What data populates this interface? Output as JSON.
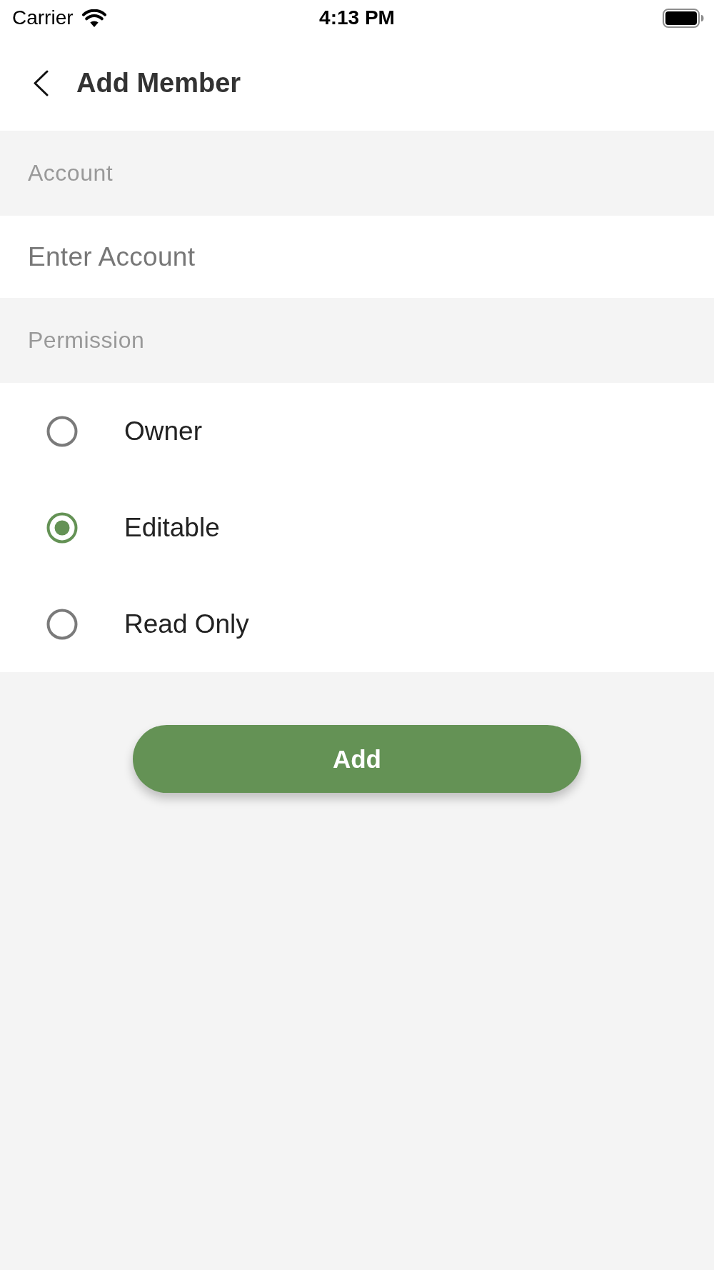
{
  "status_bar": {
    "carrier": "Carrier",
    "time": "4:13 PM"
  },
  "header": {
    "title": "Add Member"
  },
  "account": {
    "label": "Account",
    "field": {
      "placeholder": "Enter Account"
    }
  },
  "permission": {
    "label": "Permission",
    "options": [
      {
        "label": "Owner",
        "selected": false
      },
      {
        "label": "Editable",
        "selected": true
      },
      {
        "label": "Read Only",
        "selected": false
      }
    ]
  },
  "add_button": {
    "label": "Add"
  }
}
